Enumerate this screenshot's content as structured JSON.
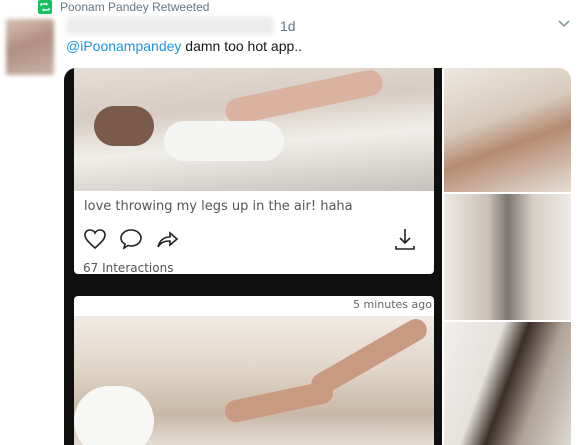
{
  "retweet": {
    "label": "Poonam Pandey Retweeted",
    "icon": "retweet-icon",
    "icon_color": "#17bf63"
  },
  "tweet": {
    "time": "1d",
    "mention": "@iPoonampandey",
    "text": " damn too hot app.."
  },
  "card1": {
    "caption": "love throwing my legs up in the air! haha",
    "interactions": "67 Interactions",
    "actions": [
      "heart-icon",
      "comment-icon",
      "share-icon",
      "download-icon"
    ]
  },
  "card2": {
    "time": "5 minutes ago"
  },
  "colors": {
    "link": "#1b95e0",
    "muted": "#657786"
  }
}
